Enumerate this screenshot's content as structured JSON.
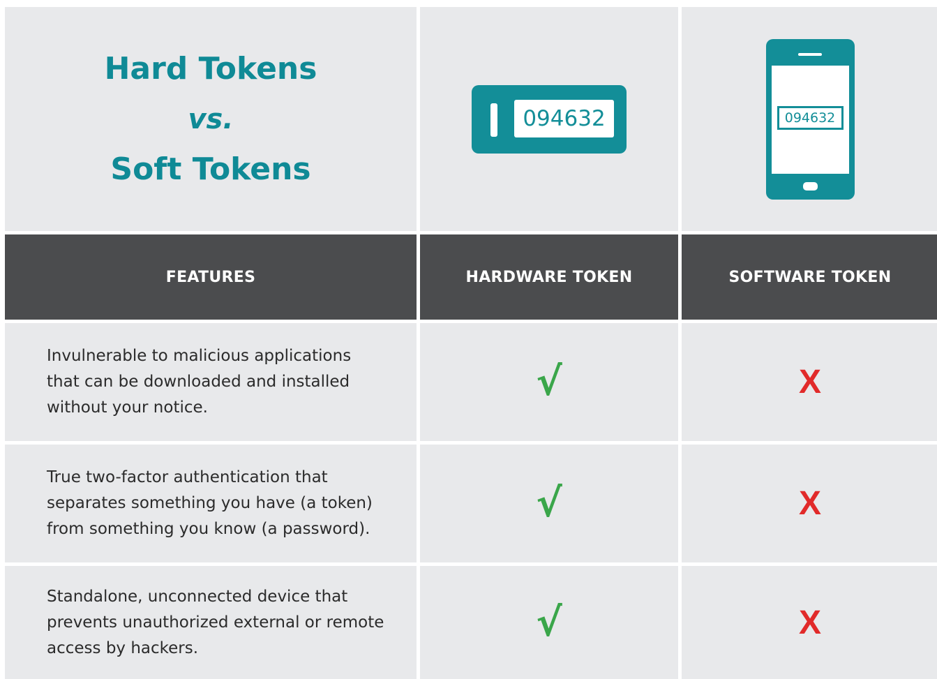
{
  "title": {
    "line1": "Hard Tokens",
    "vs": "vs.",
    "line2": "Soft Tokens"
  },
  "hardware_display": "094632",
  "software_display": "094632",
  "headers": {
    "features": "FEATURES",
    "hardware": "HARDWARE TOKEN",
    "software": "SOFTWARE TOKEN"
  },
  "rows": [
    {
      "feature": "Invulnerable to malicious applications that can be downloaded and installed without your notice.",
      "hardware": "√",
      "software": "X"
    },
    {
      "feature": "True two-factor authentication that separates something you have (a token) from something you know (a password).",
      "hardware": "√",
      "software": "X"
    },
    {
      "feature": "Standalone, unconnected device that prevents unauthorized external or remote access by hackers.",
      "hardware": "√",
      "software": "X"
    }
  ],
  "colors": {
    "accent": "#138e98",
    "title": "#0f8a96",
    "header_bg": "#4b4c4e",
    "cell_bg": "#e8e9eb",
    "check": "#3aa64a",
    "cross": "#e12a2a"
  },
  "icons": {
    "hardware": "hardware-token-icon",
    "software": "smartphone-icon"
  }
}
